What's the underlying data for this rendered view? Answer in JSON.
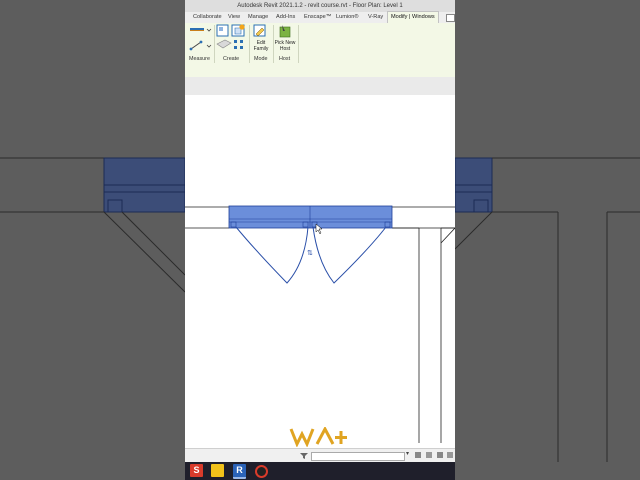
{
  "window": {
    "title": "Autodesk Revit 2021.1.2 - revit course.rvt - Floor Plan: Level 1"
  },
  "ribbon": {
    "tabs": [
      {
        "label": "Collaborate"
      },
      {
        "label": "View"
      },
      {
        "label": "Manage"
      },
      {
        "label": "Add-Ins"
      },
      {
        "label": "Enscape™"
      },
      {
        "label": "Lumion®"
      },
      {
        "label": "V-Ray"
      },
      {
        "label": "Modify | Windows"
      }
    ],
    "panels": {
      "measure": "Measure",
      "create": "Create",
      "mode": "Mode",
      "host": "Host"
    },
    "buttons": {
      "edit_family": "Edit Family",
      "pick_new_host": "Pick New Host"
    }
  },
  "watermark": {
    "logo": "WA+"
  },
  "taskbar": {
    "apps": [
      {
        "icon": "s-app-icon",
        "label": "S"
      },
      {
        "icon": "sticky-app-icon",
        "label": ""
      },
      {
        "icon": "revit-icon",
        "label": "R"
      },
      {
        "icon": "recorder-icon",
        "label": ""
      }
    ]
  },
  "colors": {
    "selection_fill": "#5b82d6",
    "selection_stroke": "#1f3f9a",
    "ribbon_bg": "#f3f8e6",
    "dim_overlay": "#5d5d5d",
    "logo": "#e0a422"
  }
}
